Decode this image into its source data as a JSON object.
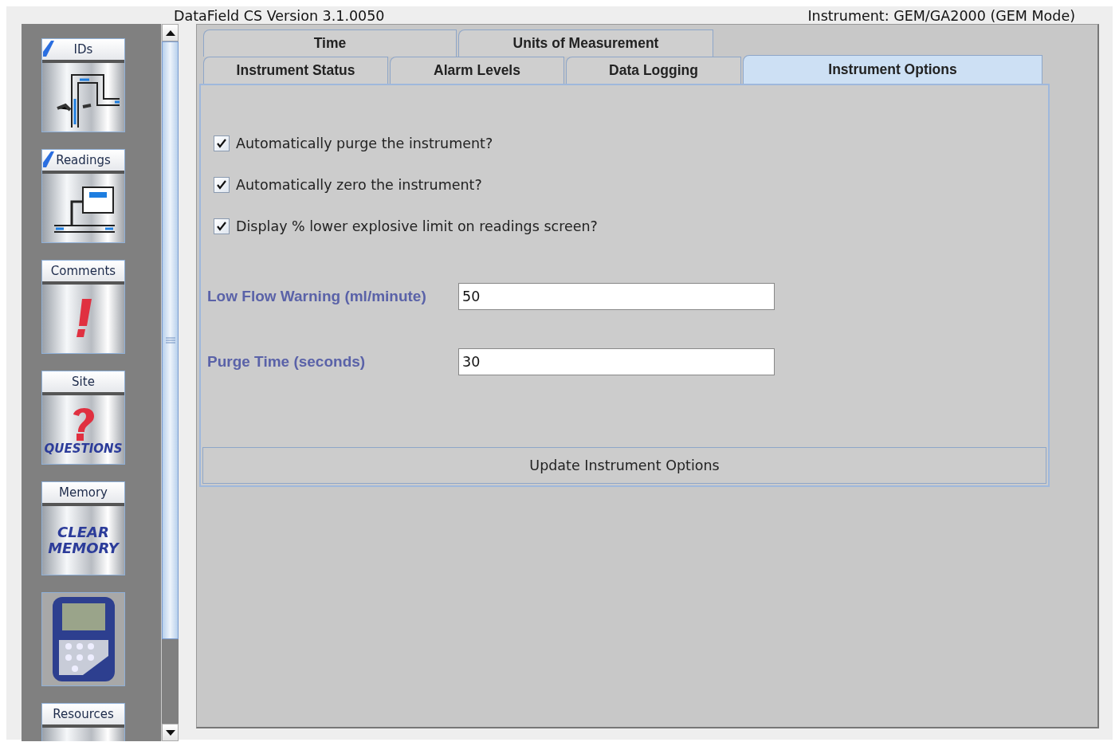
{
  "header": {
    "title": "DataField CS Version 3.1.0050",
    "instrument": "Instrument: GEM/GA2000 (GEM Mode)"
  },
  "sidebar": {
    "items": [
      {
        "kind": "ids",
        "label": "IDs",
        "checked": true
      },
      {
        "kind": "readings",
        "label": "Readings",
        "checked": true
      },
      {
        "kind": "comments",
        "label": "Comments",
        "checked": false
      },
      {
        "kind": "site",
        "label": "Site",
        "checked": false,
        "picture_text": [
          "QUESTIONS"
        ]
      },
      {
        "kind": "memory",
        "label": "Memory",
        "checked": false,
        "picture_text": [
          "CLEAR",
          "MEMORY"
        ]
      },
      {
        "kind": "device",
        "checked": false
      },
      {
        "kind": "resources",
        "label": "Resources",
        "checked": false
      }
    ]
  },
  "tabs": [
    [
      {
        "label": "Time",
        "selected": false
      },
      {
        "label": "Units of Measurement",
        "selected": false
      }
    ],
    [
      {
        "label": "Instrument Status",
        "selected": false
      },
      {
        "label": "Alarm Levels",
        "selected": false
      },
      {
        "label": "Data Logging",
        "selected": false
      },
      {
        "label": "Instrument Options",
        "selected": true
      }
    ]
  ],
  "options": [
    {
      "label": "Automatically purge the instrument?",
      "checked": true
    },
    {
      "label": "Automatically zero the instrument?",
      "checked": true
    },
    {
      "label": "Display % lower explosive limit on readings screen?",
      "checked": true
    }
  ],
  "fields": [
    {
      "label": "Low Flow Warning (ml/minute)",
      "value": "50"
    },
    {
      "label": "Purge Time (seconds)",
      "value": "30"
    }
  ],
  "update_button": "Update Instrument Options"
}
